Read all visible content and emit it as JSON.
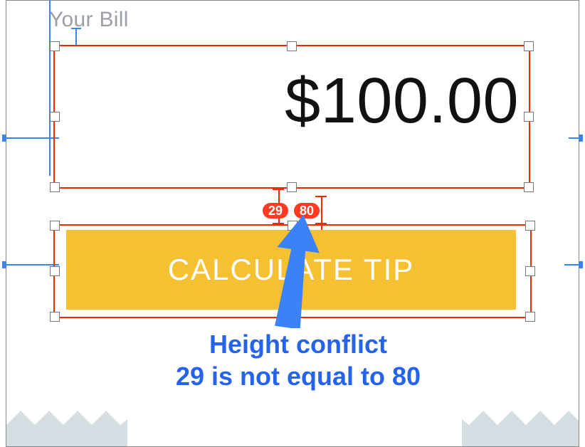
{
  "label_text": "Your Bill",
  "amount_text": "$100.00",
  "button_text": "CALCULATE TIP",
  "constraint_badges": {
    "a": "29",
    "b": "80"
  },
  "annotation_line1": "Height conflict",
  "annotation_line2": "29 is not equal to 80",
  "colors": {
    "selection": "#ef2b00",
    "guide": "#3b82f6",
    "button_fill": "#f5c032",
    "badge": "#ff3b22",
    "annotation": "#2563eb",
    "torn": "#d5dee3"
  }
}
